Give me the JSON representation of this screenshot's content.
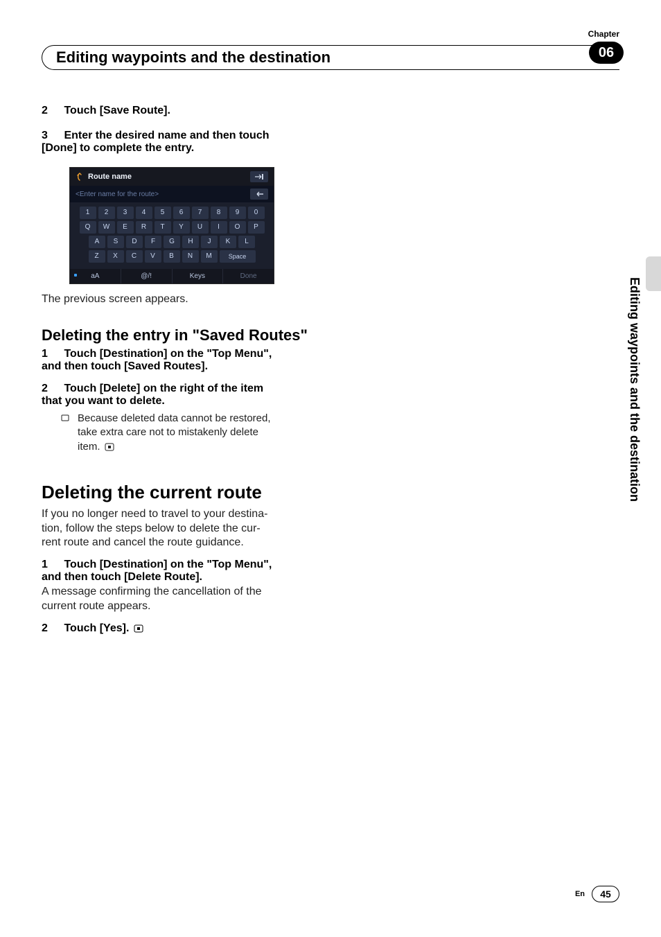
{
  "header": {
    "chapter_label": "Chapter",
    "chapter_number": "06",
    "title": "Editing waypoints and the destination"
  },
  "side": {
    "label": "Editing waypoints and the destination"
  },
  "keyboard": {
    "title": "Route name",
    "placeholder": "<Enter name for the route>",
    "row1": [
      "1",
      "2",
      "3",
      "4",
      "5",
      "6",
      "7",
      "8",
      "9",
      "0"
    ],
    "row2": [
      "Q",
      "W",
      "E",
      "R",
      "T",
      "Y",
      "U",
      "I",
      "O",
      "P"
    ],
    "row3": [
      "A",
      "S",
      "D",
      "F",
      "G",
      "H",
      "J",
      "K",
      "L"
    ],
    "row4": [
      "Z",
      "X",
      "C",
      "V",
      "B",
      "N",
      "M"
    ],
    "space": "Space",
    "bottom": [
      "aA",
      "@/!",
      "Keys",
      "Done"
    ]
  },
  "steps": {
    "s2_num": "2",
    "s2_text": "Touch [Save Route].",
    "s3_num": "3",
    "s3_text_a": "Enter the desired name and then touch",
    "s3_text_b": "[Done] to complete the entry.",
    "prev_screen": "The previous screen appears."
  },
  "delete_saved": {
    "heading_a": "Deleting the entry in ",
    "heading_b": "\"Saved Routes\"",
    "s1_num": "1",
    "s1_a": "Touch [Destination] on the \"Top Menu\",",
    "s1_b": "and then touch [Saved Routes].",
    "s2_num": "2",
    "s2_a": "Touch [Delete] on the right of the item",
    "s2_b": "that you want to delete.",
    "note_a": "Because deleted data cannot be restored,",
    "note_b": "take extra care not to mistakenly delete",
    "note_c": "item."
  },
  "delete_current": {
    "heading": "Deleting the current route",
    "intro_a": "If you no longer need to travel to your destina-",
    "intro_b": "tion, follow the steps below to delete the cur-",
    "intro_c": "rent route and cancel the route guidance.",
    "s1_num": "1",
    "s1_a": "Touch [Destination] on the \"Top Menu\",",
    "s1_b": "and then touch [Delete Route].",
    "s1_after_a": "A message confirming the cancellation of the",
    "s1_after_b": "current route appears.",
    "s2_num": "2",
    "s2_text": "Touch [Yes]."
  },
  "footer": {
    "lang": "En",
    "page": "45"
  }
}
